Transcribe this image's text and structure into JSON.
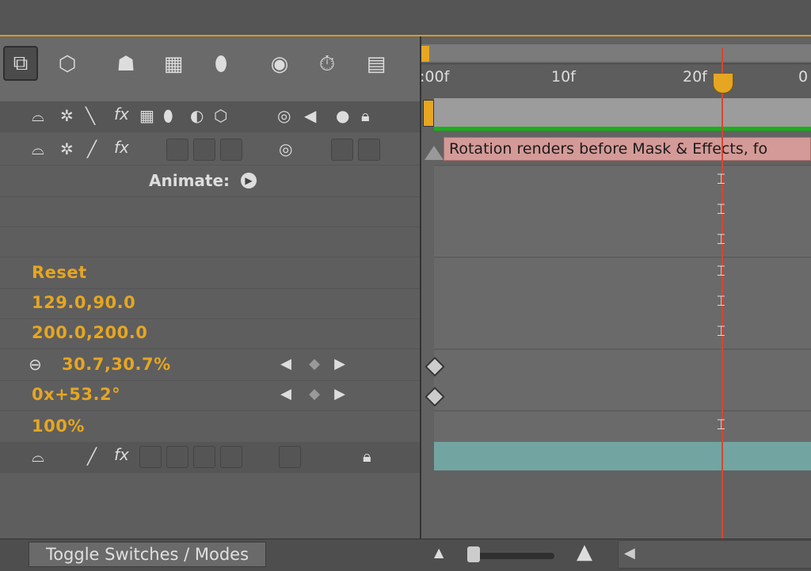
{
  "toolbar": {
    "tools": [
      "comp-marker-icon",
      "draft-3d-icon",
      "hide-shy-icon",
      "frame-blending-icon",
      "motion-blur-icon",
      "brainstorm-icon",
      "auto-keyframe-icon",
      "graph-editor-icon"
    ]
  },
  "switches_header": {
    "icons_left": [
      "shy-icon",
      "collapse-icon",
      "quality-icon",
      "fx-icon",
      "frame-blend-icon",
      "motion-blur-icon",
      "adjustment-icon",
      "3d-icon"
    ],
    "icons_av": [
      "video-eye-icon",
      "audio-icon",
      "solo-icon",
      "lock-icon"
    ]
  },
  "animate_label": "Animate:",
  "properties": [
    {
      "value": "Reset"
    },
    {
      "value": "129.0,90.0"
    },
    {
      "value": "200.0,200.0"
    },
    {
      "value": "30.7,30.7%",
      "linked": true
    },
    {
      "value": "0x+53.2°"
    },
    {
      "value": "100%"
    }
  ],
  "ruler": {
    "ticks": [
      ":00f",
      "10f",
      "20f",
      "0"
    ]
  },
  "error_message": "Rotation renders before Mask & Effects, fo",
  "bottom": {
    "toggle_label": "Toggle Switches / Modes"
  },
  "colors": {
    "accent": "#e6a621",
    "playhead": "#d64632",
    "work_area_green": "#19b01a",
    "layer_bar": "#72a5a1",
    "error_bg": "#d49a97"
  }
}
